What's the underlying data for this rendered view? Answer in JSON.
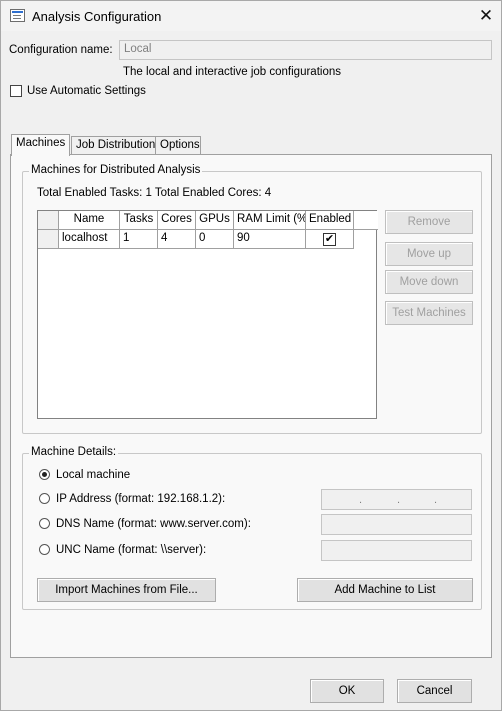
{
  "window": {
    "title": "Analysis Configuration",
    "close_glyph": "✕"
  },
  "config": {
    "name_label": "Configuration name:",
    "name_value": "Local",
    "description": "The local and interactive job configurations",
    "auto_settings_label": "Use Automatic Settings",
    "auto_settings_checked": false
  },
  "tabs": [
    {
      "label": "Machines",
      "active": true
    },
    {
      "label": "Job Distribution",
      "active": false
    },
    {
      "label": "Options",
      "active": false
    }
  ],
  "machines": {
    "group_title": "Machines for Distributed Analysis",
    "summary": "Total Enabled Tasks: 1  Total Enabled Cores: 4",
    "columns": [
      "Name",
      "Tasks",
      "Cores",
      "GPUs",
      "RAM Limit (%)",
      "Enabled"
    ],
    "rows": [
      {
        "name": "localhost",
        "tasks": "1",
        "cores": "4",
        "gpus": "0",
        "ram": "90",
        "enabled": true
      }
    ],
    "check_glyph": "✔",
    "buttons": {
      "remove": "Remove",
      "move_up": "Move up",
      "move_down": "Move down",
      "test": "Test Machines"
    }
  },
  "details": {
    "group_title": "Machine Details:",
    "options": {
      "local": "Local machine",
      "ip": "IP Address (format: 192.168.1.2):",
      "dns": "DNS Name (format: www.server.com):",
      "unc": "UNC Name (format: \\\\server):"
    },
    "selected": "local",
    "ip_dot": ".",
    "import_button": "Import Machines from File...",
    "add_button": "Add Machine to List"
  },
  "footer": {
    "ok": "OK",
    "cancel": "Cancel"
  }
}
